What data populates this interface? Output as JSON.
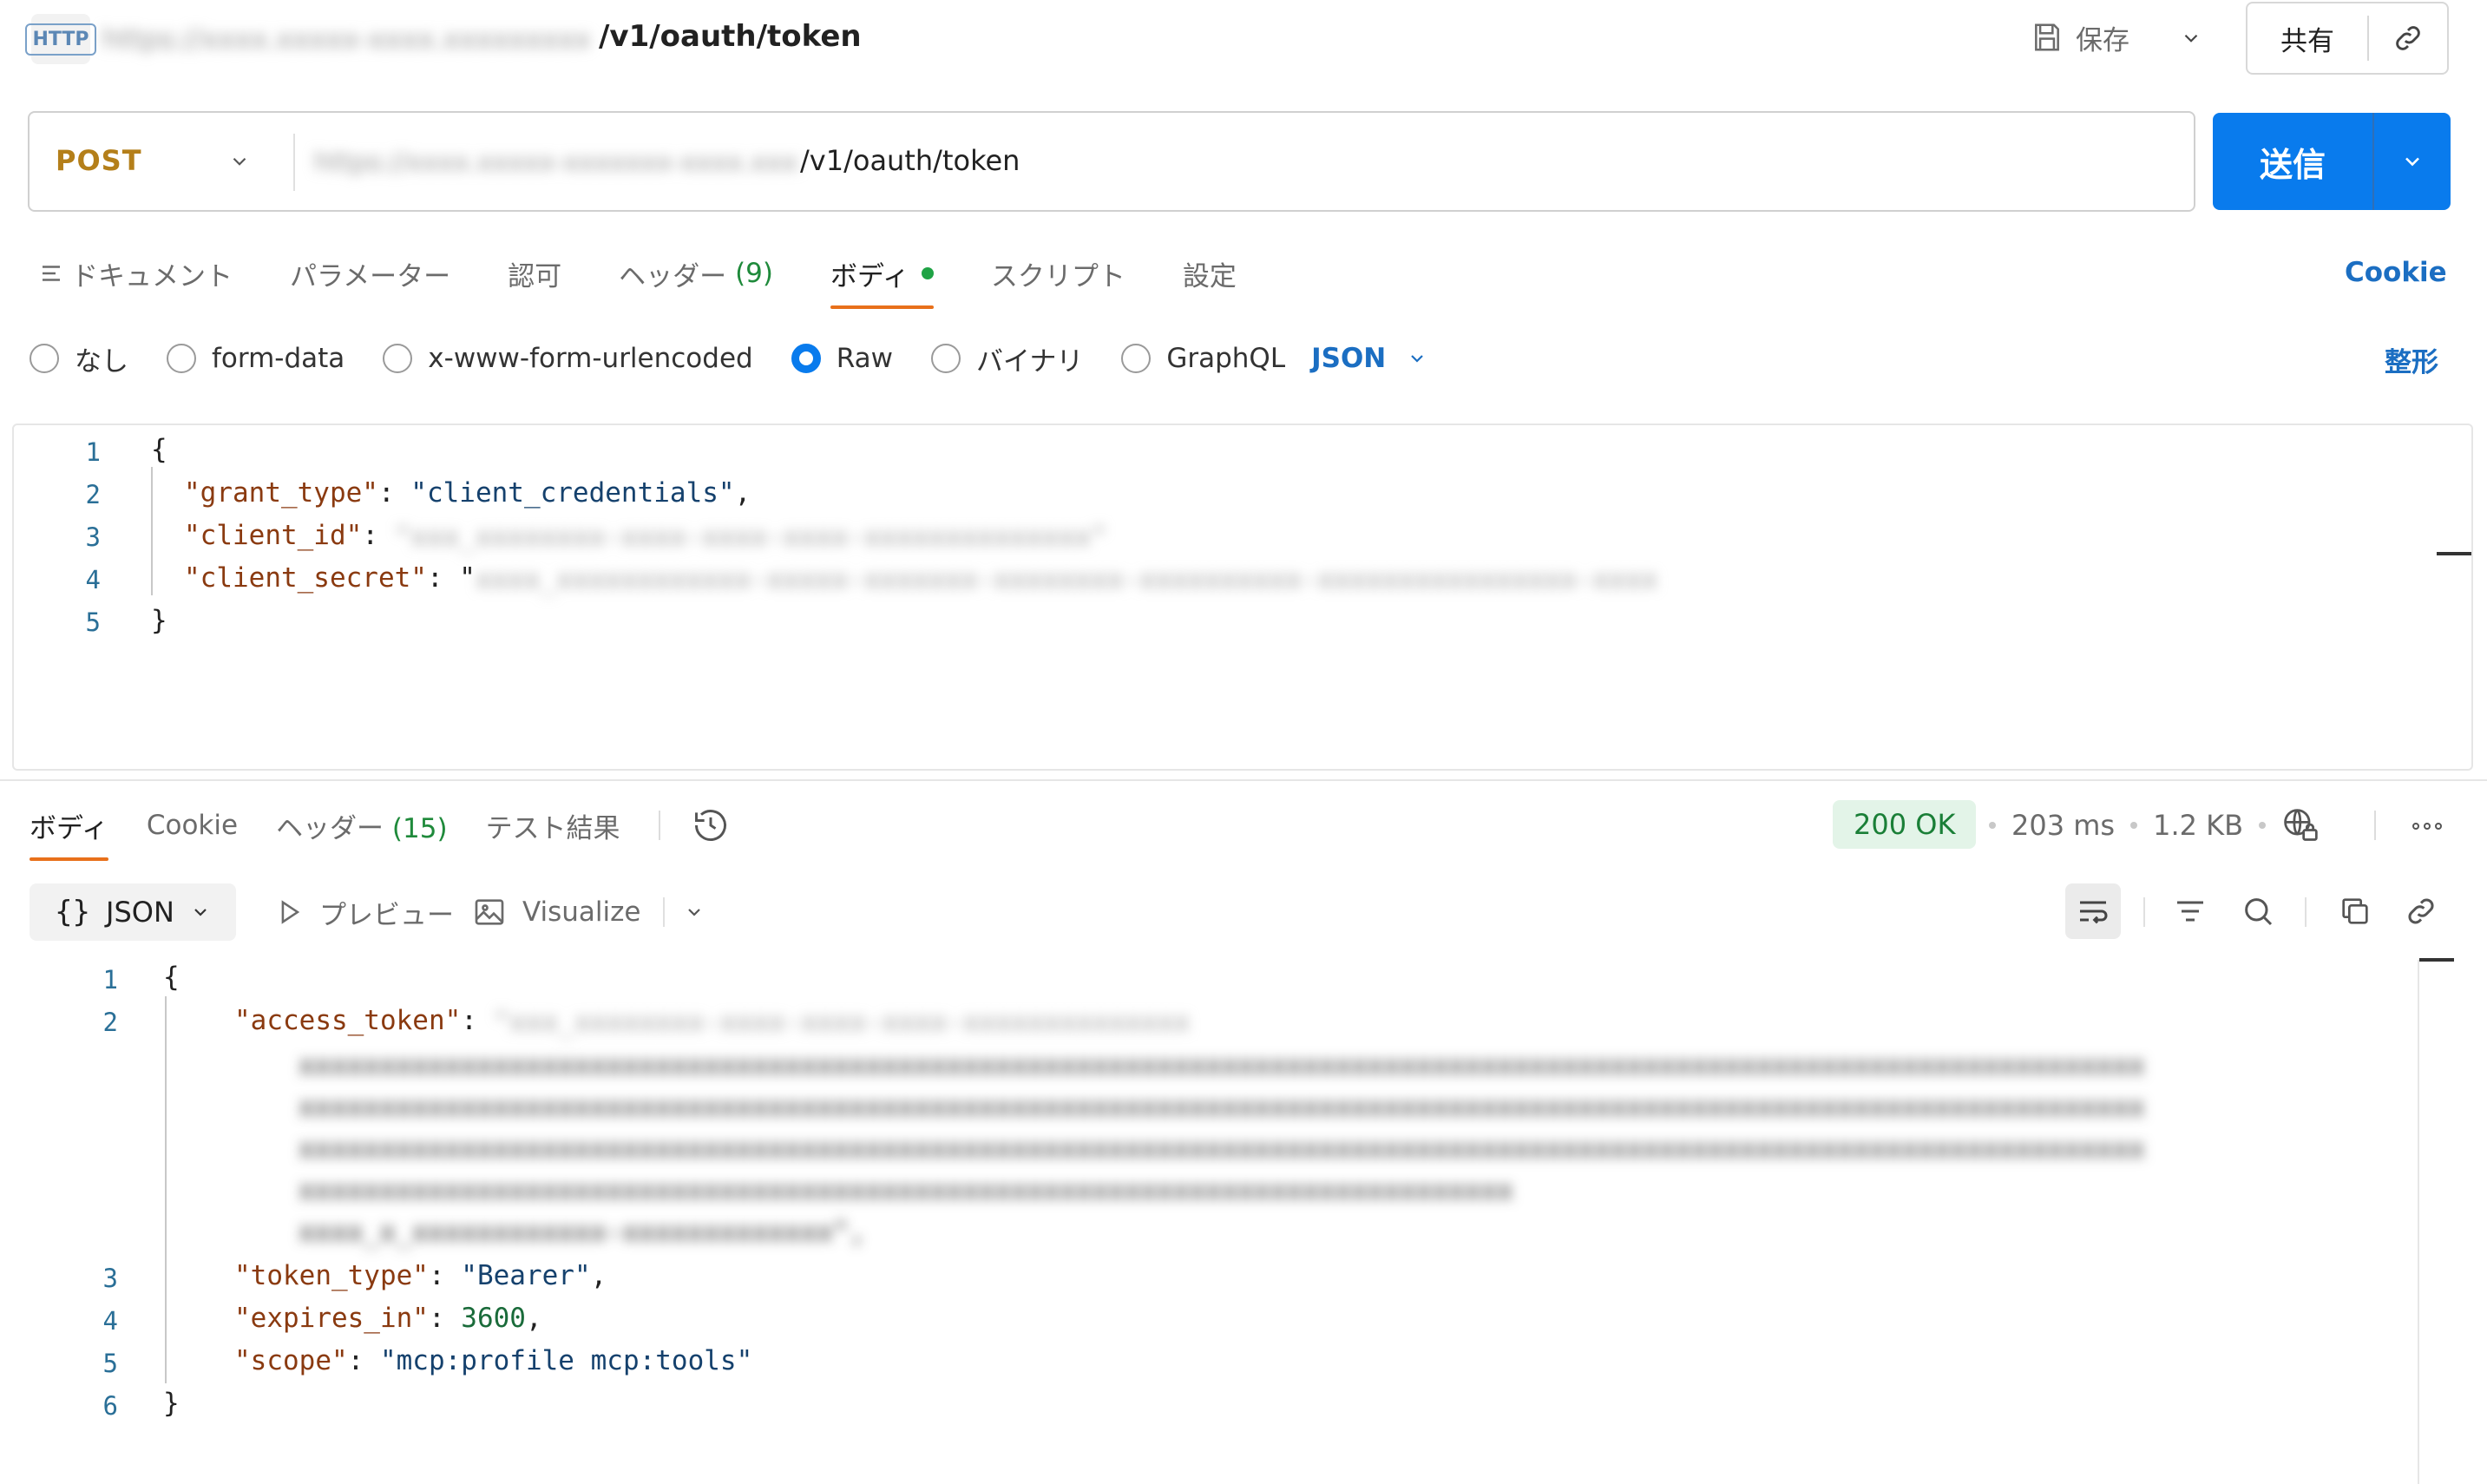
{
  "header": {
    "badge": "HTTP",
    "url_host": "https://xxxx.xxxxx-xxxx.xxxxxxxxxxxxxx",
    "url_path": "/v1/oauth/token",
    "save_label": "保存",
    "share_label": "共有"
  },
  "request": {
    "method": "POST",
    "url_host": "https://xxxx.xxxxx-xxxxxxx-xxxx.xxxxxxxxxxxx",
    "url_path": "/v1/oauth/token",
    "send_label": "送信"
  },
  "request_tabs": {
    "docs": "ドキュメント",
    "params": "パラメーター",
    "auth": "認可",
    "headers": "ヘッダー",
    "headers_count": "(9)",
    "body": "ボディ",
    "scripts": "スクリプト",
    "settings": "設定",
    "cookie": "Cookie"
  },
  "body_types": {
    "none": "なし",
    "form_data": "form-data",
    "urlencoded": "x-www-form-urlencoded",
    "raw": "Raw",
    "binary": "バイナリ",
    "graphql": "GraphQL",
    "format": "JSON",
    "beautify": "整形",
    "selected": "Raw"
  },
  "request_body": {
    "line_numbers": [
      "1",
      "2",
      "3",
      "4",
      "5"
    ],
    "open_brace": "{",
    "close_brace": "}",
    "grant_type_key": "\"grant_type\"",
    "grant_type_value": "\"client_credentials\"",
    "client_id_key": "\"client_id\"",
    "client_id_value_masked": "\"xxx_xxxxxxxx-xxxx-xxxx-xxxx-xxxxxxxxxxxxxx\"",
    "client_secret_key": "\"client_secret\"",
    "client_secret_value_masked": "xxxx_xxxxxxxxxxxx-xxxxx-xxxxxxx-xxxxxxxx-xxxxxxxxxx-xxxxxxxxxxxxxxxx-xxxxxxxxxx\""
  },
  "response_tabs": {
    "body": "ボディ",
    "cookie": "Cookie",
    "headers": "ヘッダー",
    "headers_count": "(15)",
    "tests": "テスト結果"
  },
  "response_meta": {
    "status": "200 OK",
    "time": "203 ms",
    "size": "1.2 KB"
  },
  "response_toolbar": {
    "format": "JSON",
    "preview": "プレビュー",
    "visualize": "Visualize"
  },
  "response_body": {
    "line_numbers": [
      "1",
      "2",
      "3",
      "4",
      "5",
      "6"
    ],
    "open_brace": "{",
    "close_brace": "}",
    "access_token_key": "\"access_token\"",
    "access_token_value_masked": [
      "\"xxx_xxxxxxxx-xxxx-xxxx-xxxx-xxxxxxxxxxxxxx",
      "xxxxxxxxxxxxxxxxxxxxxxxxxxxxxxxxxxxxxxxxxxxxxxxxxxxxxxxxxxxxxxxxxxxxxxxxxxxxxxxxxxxxxxxxxxxxxxxxxxxxxxxxxxxxxxxxxx",
      "xxxxxxxxxxxxxxxxxxxxxxxxxxxxxxxxxxxxxxxxxxxxxxxxxxxxxxxxxxxxxxxxxxxxxxxxxxxxxxxxxxxxxxxxxxxxxxxxxxxxxxxxxxxxxxxxxx",
      "xxxxxxxxxxxxxxxxxxxxxxxxxxxxxxxxxxxxxxxxxxxxxxxxxxxxxxxxxxxxxxxxxxxxxxxxxxxxxxxxxxxxxxxxxxxxxxxxxxxxxxxxxxxxxxxxxx",
      "xxxxxxxxxxxxxxxxxxxxxxxxxxxxxxxxxxxxxxxxxxxxxxxxxxxxxxxxxxxxxxxxxxxxxxxxxxx",
      "xxxx_x_xxxxxxxxxxxx-xxxxxxxxxxxxx\","
    ],
    "token_type_key": "\"token_type\"",
    "token_type_value": "\"Bearer\"",
    "expires_in_key": "\"expires_in\"",
    "expires_in_value": "3600",
    "scope_key": "\"scope\"",
    "scope_value": "\"mcp:profile mcp:tools\""
  }
}
